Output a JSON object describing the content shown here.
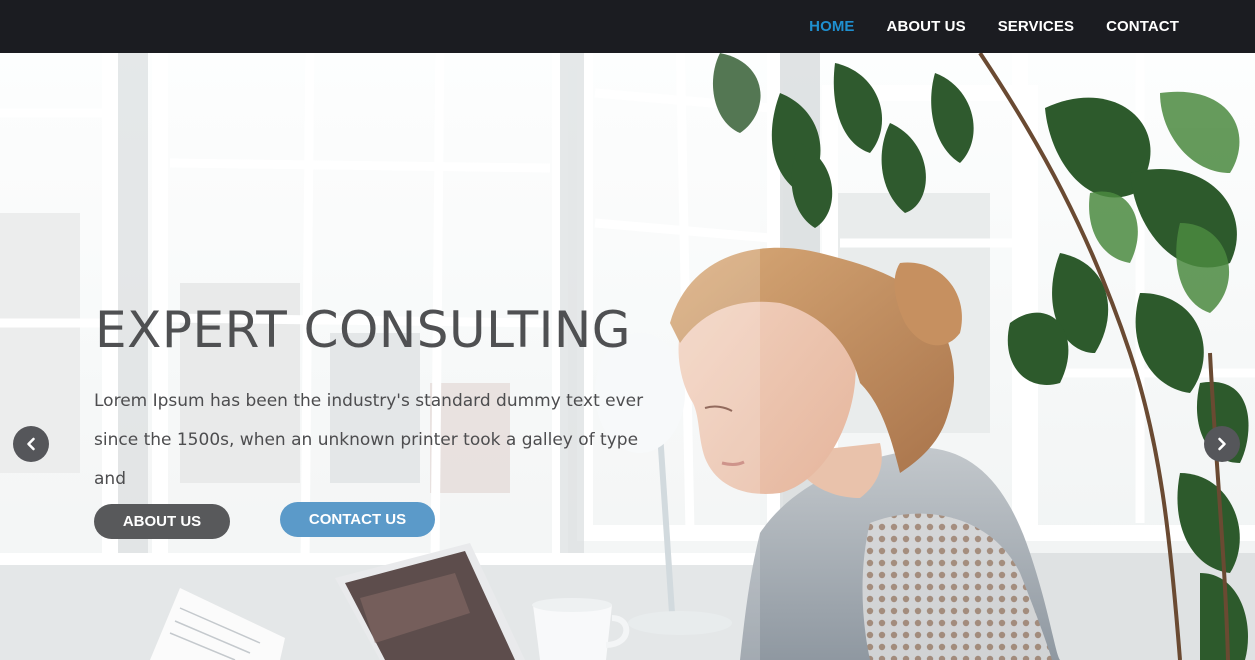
{
  "nav": {
    "items": [
      {
        "label": "HOME",
        "active": true
      },
      {
        "label": "ABOUT US",
        "active": false
      },
      {
        "label": "SERVICES",
        "active": false
      },
      {
        "label": "CONTACT",
        "active": false
      }
    ]
  },
  "hero": {
    "title": "EXPERT CONSULTING",
    "description_line1": "Lorem Ipsum has been the industry's standard dummy text ever",
    "description_line2": "since the 1500s, when an unknown printer took a galley of type and",
    "buttons": {
      "about_label": "ABOUT US",
      "contact_label": "CONTACT US"
    }
  },
  "carousel": {
    "prev_icon": "chevron-left-icon",
    "next_icon": "chevron-right-icon"
  },
  "colors": {
    "navbar_bg": "#1b1c21",
    "nav_active": "#1f8fcf",
    "about_button": "#58595b",
    "contact_button": "#5b9ac9"
  }
}
